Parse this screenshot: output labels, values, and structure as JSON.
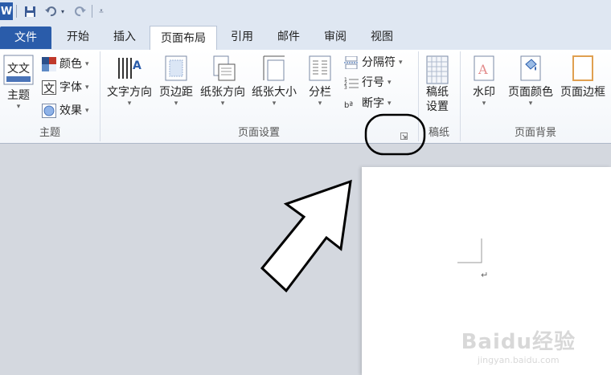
{
  "app": {
    "icon_letter": "W"
  },
  "tabs": [
    {
      "label": "文件"
    },
    {
      "label": "开始"
    },
    {
      "label": "插入"
    },
    {
      "label": "页面布局"
    },
    {
      "label": "引用"
    },
    {
      "label": "邮件"
    },
    {
      "label": "审阅"
    },
    {
      "label": "视图"
    }
  ],
  "ribbon": {
    "theme": {
      "group_label": "主题",
      "theme_label": "主题",
      "colors_label": "颜色",
      "fonts_label": "字体",
      "effects_label": "效果",
      "theme_icon_text": "文文",
      "fonts_icon_text": "文"
    },
    "page_setup": {
      "group_label": "页面设置",
      "text_direction": "文字方向",
      "margins": "页边距",
      "orientation": "纸张方向",
      "size": "纸张大小",
      "columns": "分栏",
      "breaks": "分隔符",
      "line_numbers": "行号",
      "hyphenation": "断字",
      "hyphen_icon_text": "bª"
    },
    "manuscript": {
      "group_label": "稿纸",
      "button_label_1": "稿纸",
      "button_label_2": "设置"
    },
    "page_background": {
      "group_label": "页面背景",
      "watermark": "水印",
      "page_color": "页面颜色",
      "page_borders": "页面边框",
      "watermark_icon_text": "A"
    }
  },
  "document": {
    "paragraph_mark": "↵"
  },
  "watermark": {
    "logo_text": "Baidu经验",
    "url": "jingyan.baidu.com"
  },
  "colors": {
    "file_tab": "#2a5caa",
    "ribbon_bg": "#ffffff",
    "workspace_bg": "#d4d8df"
  }
}
